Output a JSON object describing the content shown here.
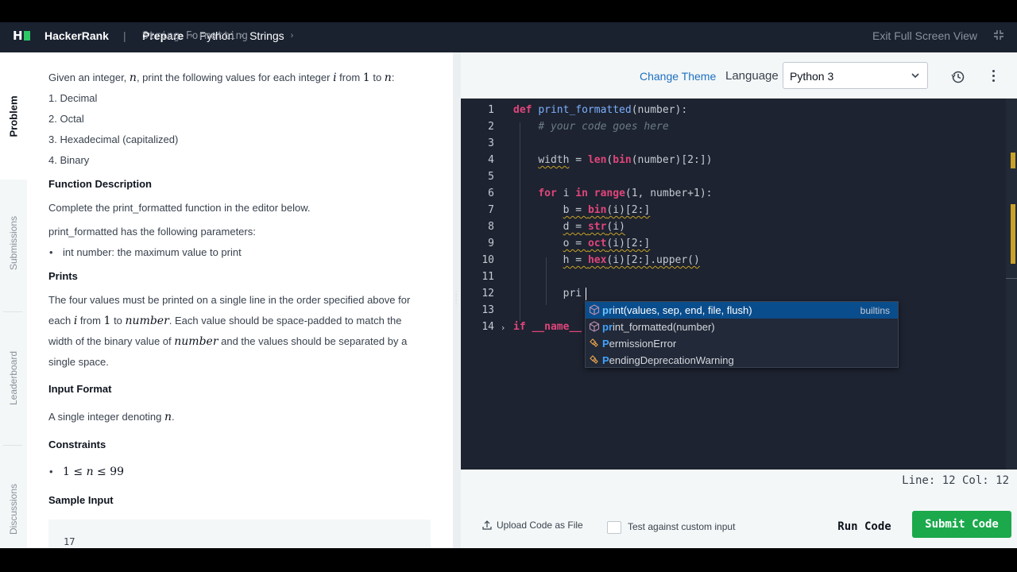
{
  "nav": {
    "brand": "HackerRank",
    "separator": "|",
    "breadcrumbs": [
      "Prepare",
      "Python",
      "Strings",
      "String Formatting"
    ],
    "exit_fullscreen": "Exit Full Screen View"
  },
  "sidetabs": [
    "Problem",
    "Submissions",
    "Leaderboard",
    "Discussions"
  ],
  "problem": {
    "intro_a": "Given an integer, ",
    "intro_n": "n",
    "intro_b": ", print the following values for each integer ",
    "intro_i": "i",
    "intro_c": " from ",
    "intro_one": "1",
    "intro_d": " to ",
    "intro_n2": "n",
    "intro_e": ":",
    "list": [
      "1.   Decimal",
      "2.   Octal",
      "3.   Hexadecimal (capitalized)",
      "4.   Binary"
    ],
    "function_desc_heading": "Function Description",
    "function_desc": "Complete the print_formatted function in the editor below.",
    "params_intro": "print_formatted has the following parameters:",
    "param_1": "int number: the maximum value to print",
    "prints_heading": "Prints",
    "prints_1": "The four values must be printed on a single line in the order specified above for",
    "prints_2a": "each ",
    "prints_2i": "i",
    "prints_2b": " from ",
    "prints_2one": "1",
    "prints_2c": " to ",
    "prints_2num": "number",
    "prints_2d": ". Each value should be space-padded to match the",
    "prints_3a": "width of the binary value of ",
    "prints_3num": "number",
    "prints_3b": " and the values should be separated by a",
    "prints_4": "single space.",
    "input_heading": "Input Format",
    "input_a": "A single integer denoting ",
    "input_n": "n",
    "input_b": ".",
    "constraints_heading": "Constraints",
    "constraint_a": "1",
    "constraint_le1": " ≤ ",
    "constraint_n": "n",
    "constraint_le2": " ≤ ",
    "constraint_b": "99",
    "sample_input_heading": "Sample Input",
    "sample_input_value": "17"
  },
  "toolbar": {
    "change_theme": "Change Theme",
    "language_label": "Language",
    "language_value": "Python 3"
  },
  "editor": {
    "line_numbers": [
      "1",
      "2",
      "3",
      "4",
      "5",
      "6",
      "7",
      "8",
      "9",
      "10",
      "11",
      "12",
      "13",
      "14"
    ],
    "cursor_text": "pri",
    "line14_a": "if __name__",
    "suggestions": [
      {
        "match": "pr",
        "rest_pre": "",
        "after": "int(values, sep, end, file, flush)",
        "source": "builtins"
      },
      {
        "match": "pr",
        "rest_pre": "",
        "after": "int_formatted(number)",
        "source": ""
      },
      {
        "match": "P",
        "rest_pre": "",
        "after": "ermissionError",
        "source": ""
      },
      {
        "match": "P",
        "rest_pre": "",
        "after": "endingDeprecationWarning",
        "source": ""
      }
    ]
  },
  "status": {
    "position": "Line: 12 Col: 12"
  },
  "bottom": {
    "upload": "Upload Code as File",
    "custom_input": "Test against custom input",
    "run": "Run Code",
    "submit": "Submit Code"
  }
}
